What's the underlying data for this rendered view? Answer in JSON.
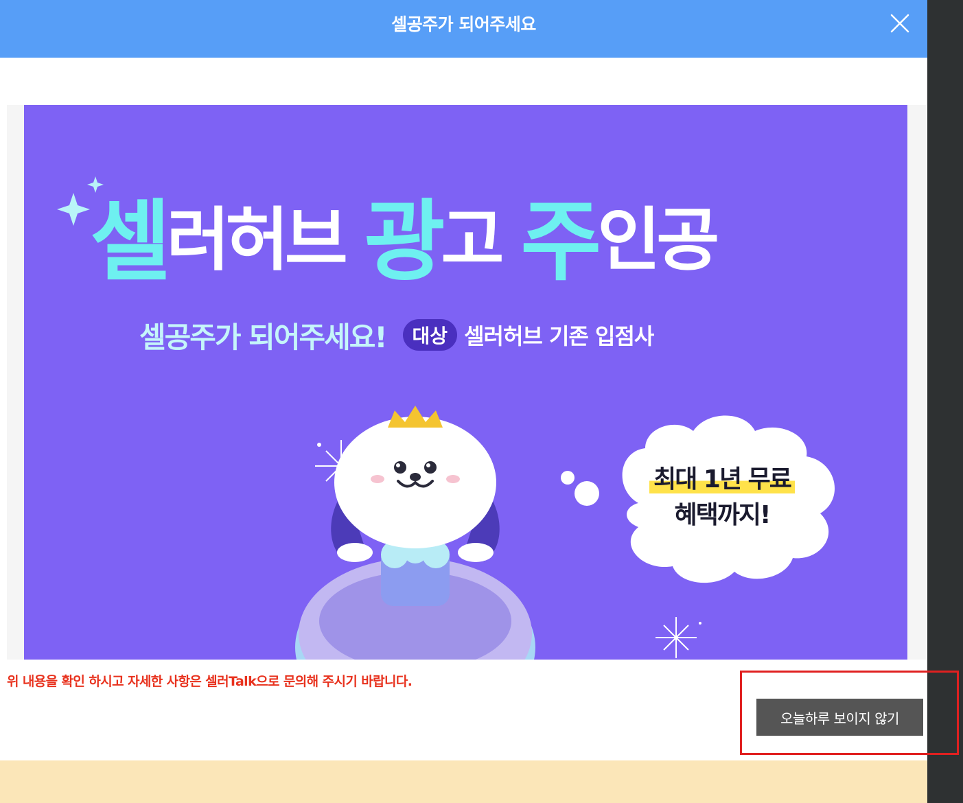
{
  "modal": {
    "title": "셀공주가 되어주세요",
    "close_icon": "close-icon"
  },
  "banner": {
    "headline_parts": [
      "셀",
      "러허브",
      "광",
      "고",
      "주",
      "인공"
    ],
    "subtitle": "셀공주가 되어주세요!",
    "target_badge": "대상",
    "target_text": "셀러허브 기존 입점사",
    "bubble_line1": "최대 1년 무료",
    "bubble_line2": "혜택까지!",
    "colors": {
      "background": "#7e62f4",
      "accent": "#6ef0f0",
      "badge": "#4a2fbf"
    }
  },
  "notice": "위 내용을 확인 하시고 자세한 사항은 셀러Talk으로 문의해 주시기 바랍니다.",
  "dismiss_button": "오늘하루 보이지 않기",
  "colors": {
    "titlebar": "#579ef7",
    "notice": "#e8321e",
    "button": "#555555",
    "highlight": "#e02020",
    "footer": "#fbe6b8"
  }
}
